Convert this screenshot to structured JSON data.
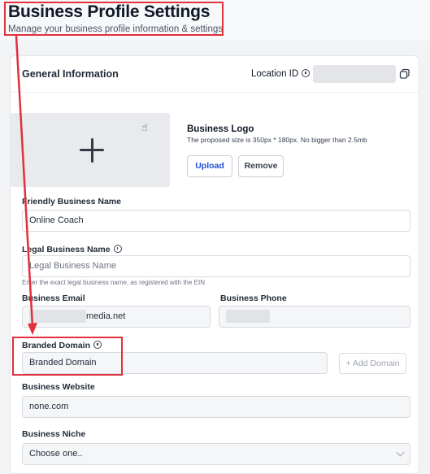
{
  "page": {
    "title": "Business Profile Settings",
    "subtitle": "Manage your business profile information & settings"
  },
  "card": {
    "title": "General Information",
    "location_label": "Location ID"
  },
  "logo": {
    "title": "Business Logo",
    "hint": "The proposed size is 350px * 180px. No bigger than 2.5mb",
    "upload_label": "Upload",
    "remove_label": "Remove"
  },
  "fields": {
    "friendly_name": {
      "label": "Friendly Business Name",
      "value": "Online Coach"
    },
    "legal_name": {
      "label": "Legal Business Name",
      "placeholder": "Legal Business Name",
      "hint": "Enter the exact legal business name, as registered with the EIN"
    },
    "email": {
      "label": "Business Email",
      "value": "media.net"
    },
    "phone": {
      "label": "Business Phone"
    },
    "branded_domain": {
      "label": "Branded Domain",
      "placeholder": "Branded Domain",
      "add_label": "+ Add Domain"
    },
    "website": {
      "label": "Business Website",
      "value": "none.com"
    },
    "niche": {
      "label": "Business Niche",
      "value": "Choose one.."
    }
  },
  "icons": {
    "info": "info-circle-icon",
    "copy": "copy-icon",
    "plus": "plus-icon",
    "cursor": "hand-cursor-icon",
    "chevron": "chevron-down-icon"
  },
  "colors": {
    "annotation": "#e0313c",
    "primary_link": "#1d4ed8"
  }
}
